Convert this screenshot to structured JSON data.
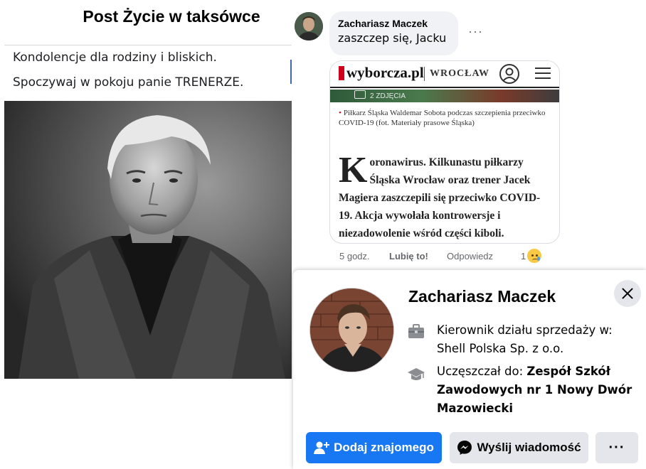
{
  "left_post": {
    "title": "Post Życie w taksówce",
    "line1": "Kondolencje dla rodziny i bliskich.",
    "line2": "Spoczywaj w pokoju panie TRENERZE."
  },
  "comment": {
    "author": "Zachariasz Maczek",
    "text": "zaszczep się, Jacku",
    "more": "···",
    "article": {
      "site": "wyborcza.pl",
      "city": "WROCŁAW",
      "badge": "2 ZDJĘCIA",
      "caption": "Piłkarz Śląska Waldemar Sobota podczas szczepienia przeciwko COVID-19 (fot. Materiały prasowe Śląska)",
      "dropcap": "K",
      "body": "oronawirus. Kilkunastu piłkarzy Śląska Wrocław oraz trener Jacek Magiera zaszczepili się przeciwko COVID-19. Akcja wywołała kontrowersje i niezadowolenie wśród części kiboli."
    },
    "actions": {
      "time": "5 godz.",
      "like": "Lubię to!",
      "reply": "Odpowiedz",
      "reaction_count": "1"
    }
  },
  "profile_card": {
    "name": "Zachariasz Maczek",
    "work": "Kierownik działu sprzedaży w: Shell Polska Sp. z o.o.",
    "edu_prefix": "Uczęszczał do: ",
    "edu_school": "Zespół Szkół Zawodowych nr 1 Nowy Dwór Mazowiecki",
    "add_friend": "Dodaj znajomego",
    "send_message": "Wyślij wiadomość",
    "more": "···"
  },
  "colors": {
    "primary": "#1877f2",
    "secondary_button": "#e4e6eb",
    "bubble": "#f0f2f5",
    "muted_text": "#65676b"
  },
  "icons": {
    "work": "briefcase-icon",
    "education": "graduation-cap-icon",
    "add_friend": "add-friend-icon",
    "messenger": "messenger-icon",
    "close": "close-icon",
    "reaction": "sad-reaction-icon"
  }
}
